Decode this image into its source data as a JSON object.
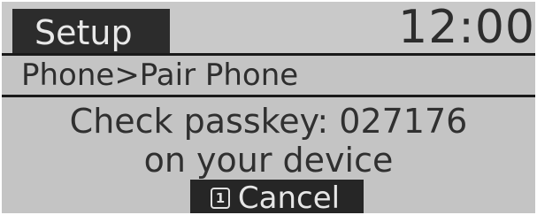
{
  "header": {
    "title": "Setup",
    "clock": "12:00"
  },
  "breadcrumb": {
    "text": "Phone>Pair Phone"
  },
  "message": {
    "line1": "Check passkey: 027176",
    "line2": "on your device"
  },
  "cancel_button": {
    "key_number": "1",
    "label": "Cancel",
    "icon": "number-one-key-icon"
  },
  "colors": {
    "lcd_background": "#c4c4c4",
    "highlight_background": "#262626",
    "highlight_text": "#e6e6e6",
    "text": "#303030"
  }
}
